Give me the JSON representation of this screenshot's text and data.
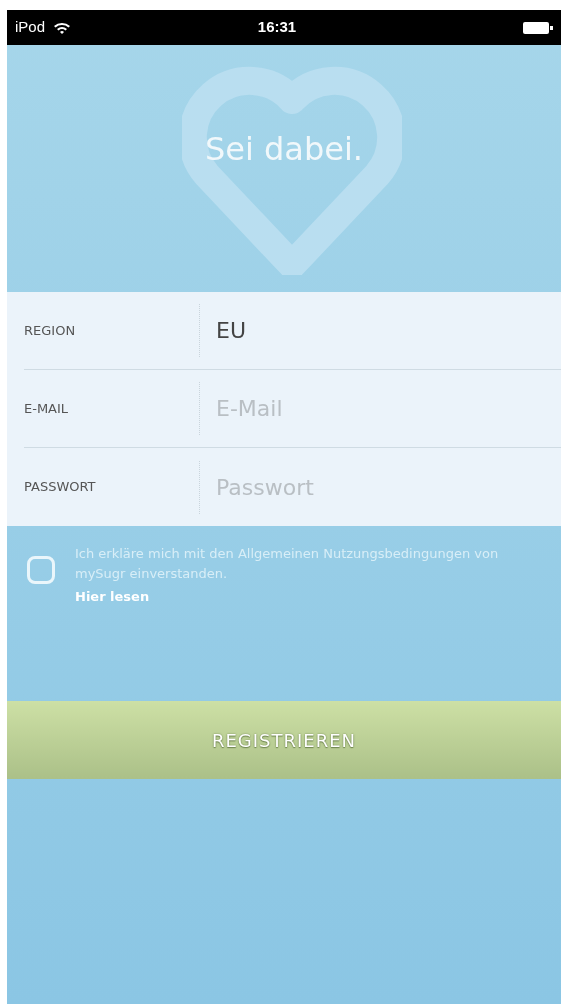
{
  "status_bar": {
    "carrier": "iPod",
    "time": "16:31"
  },
  "header": {
    "title": "Sei dabei."
  },
  "form": {
    "fields": [
      {
        "label": "REGION",
        "value": "EU"
      },
      {
        "label": "E-MAIL",
        "placeholder": "E-Mail"
      },
      {
        "label": "PASSWORT",
        "placeholder": "Passwort"
      }
    ]
  },
  "terms": {
    "checked": false,
    "text": "Ich erkläre mich mit den Allgemeinen Nutzungsbedingungen von mySugr einverstanden.",
    "link": "Hier lesen"
  },
  "register_button": {
    "label": "REGISTRIEREN",
    "disabled": true
  }
}
